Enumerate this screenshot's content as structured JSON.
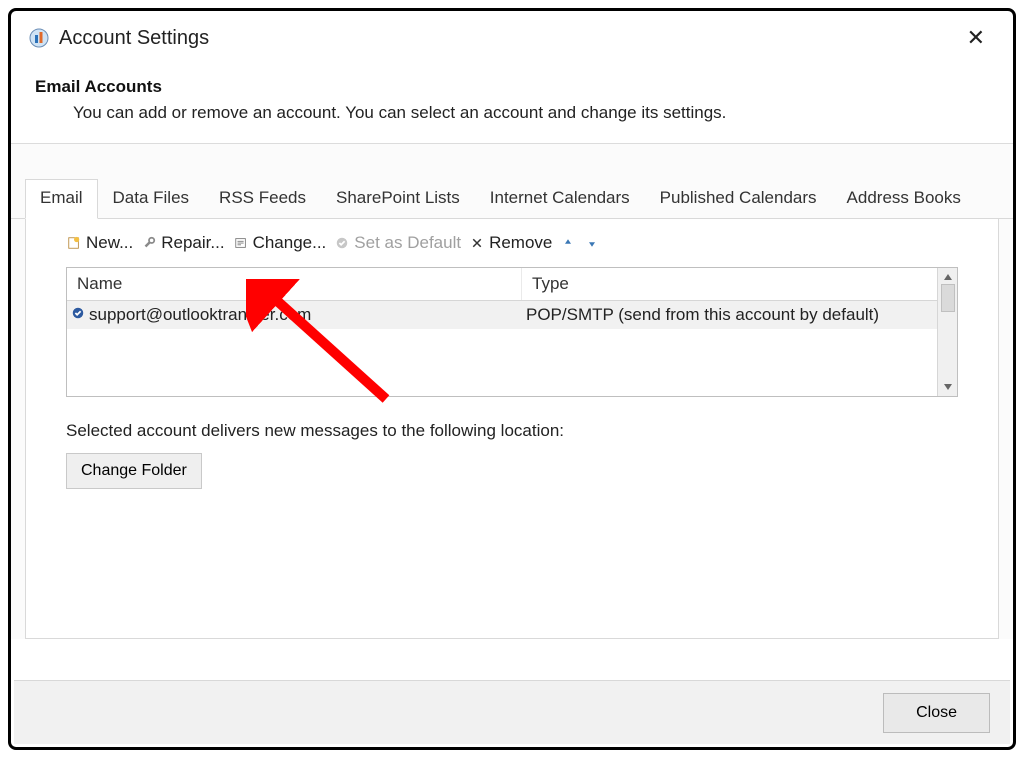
{
  "title": "Account Settings",
  "heading": "Email Accounts",
  "subheading": "You can add or remove an account. You can select an account and change its settings.",
  "tabs": [
    "Email",
    "Data Files",
    "RSS Feeds",
    "SharePoint Lists",
    "Internet Calendars",
    "Published Calendars",
    "Address Books"
  ],
  "active_tab_index": 0,
  "toolbar": {
    "new": "New...",
    "repair": "Repair...",
    "change": "Change...",
    "set_default": "Set as Default",
    "remove": "Remove"
  },
  "columns": {
    "name": "Name",
    "type": "Type"
  },
  "rows": [
    {
      "name": "support@outlooktransfer.com",
      "type": "POP/SMTP (send from this account by default)"
    }
  ],
  "delivers_text": "Selected account delivers new messages to the following location:",
  "change_folder": "Change Folder",
  "close_label": "Close"
}
